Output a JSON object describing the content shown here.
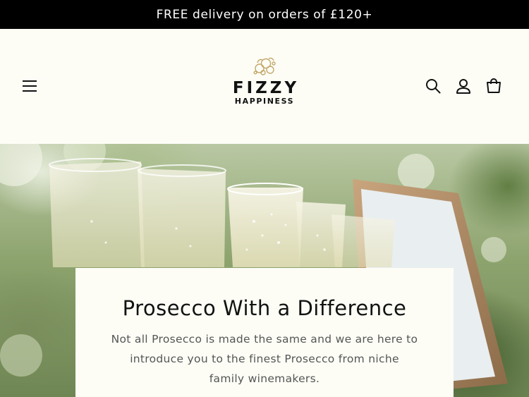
{
  "announcement": {
    "text": "FREE delivery on orders of £120+"
  },
  "header": {
    "logo": {
      "title": "FIZZY",
      "subtitle": "HAPPINESS",
      "mark_color": "#c4a76a"
    },
    "icons": {
      "menu": "menu-icon",
      "search": "search-icon",
      "account": "user-icon",
      "cart": "cart-icon"
    }
  },
  "hero": {
    "heading": "Prosecco With a Difference",
    "text": "Not all Prosecco is made the same and we are here to introduce you to the finest Prosecco from niche family winemakers."
  },
  "colors": {
    "announcement_bg": "#000000",
    "page_bg": "#fdfdf6",
    "text": "#121212",
    "muted_text": "#555555"
  }
}
